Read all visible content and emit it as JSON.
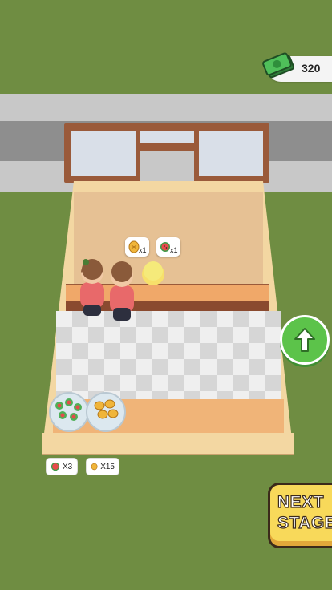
{
  "hud": {
    "money_icon": "cash-stack-icon",
    "money_value": "320"
  },
  "orders": [
    {
      "item_icon": "bread-icon",
      "quantity": "x1"
    },
    {
      "item_icon": "watermelon-icon",
      "quantity": "x1"
    }
  ],
  "inventory": [
    {
      "item_icon": "watermelon-icon",
      "quantity": "X3"
    },
    {
      "item_icon": "bread-icon",
      "quantity": "X15"
    }
  ],
  "buttons": {
    "upgrade_icon": "arrow-up-icon",
    "next_stage_line1": "NEXT",
    "next_stage_line2": "STAGE"
  },
  "colors": {
    "grass": "#6f8d42",
    "money_green": "#3fa34d",
    "upgrade_green": "#5cc34a",
    "next_yellow": "#f8d95a"
  }
}
